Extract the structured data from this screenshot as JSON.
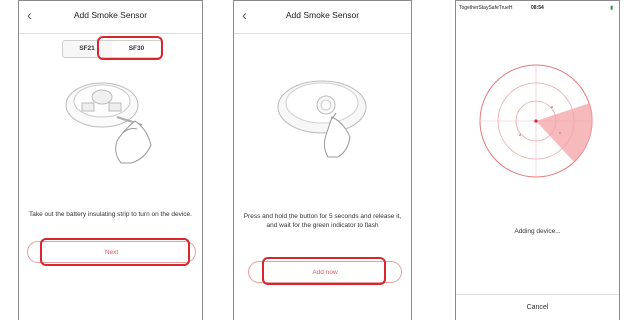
{
  "screen1": {
    "title": "Add Smoke Sensor",
    "back_icon": "chevron-left-icon",
    "tabs": [
      "SF21",
      "SF30"
    ],
    "selected_tab": "SF30",
    "instruction": "Take out the battery insulating strip to turn on the device.",
    "next_label": "Next"
  },
  "screen2": {
    "title": "Add Smoke Sensor",
    "back_icon": "chevron-left-icon",
    "instruction": "Press and hold the button for 5 seconds and release it, and wait for the green indicator to flash",
    "add_now_label": "Add now"
  },
  "screen3": {
    "status": {
      "carrier": "TogetherStaySafeTrueH",
      "time": "08:54"
    },
    "progress_text": "Adding device...",
    "cancel_label": "Cancel"
  },
  "colors": {
    "highlight": "#d9262c",
    "accent": "#e05a5e"
  }
}
